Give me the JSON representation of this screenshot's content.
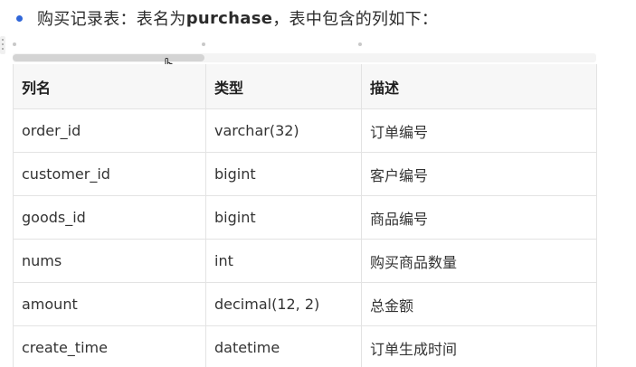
{
  "intro": {
    "prefix": "购买记录表：表名为",
    "table_name": "purchase",
    "suffix": "，表中包含的列如下："
  },
  "table": {
    "headers": [
      "列名",
      "类型",
      "描述"
    ],
    "rows": [
      [
        "order_id",
        "varchar(32)",
        "订单编号"
      ],
      [
        "customer_id",
        "bigint",
        "客户编号"
      ],
      [
        "goods_id",
        "bigint",
        "商品编号"
      ],
      [
        "nums",
        "int",
        "购买商品数量"
      ],
      [
        "amount",
        "decimal(12, 2)",
        "总金额"
      ],
      [
        "create_time",
        "datetime",
        "订单生成时间"
      ]
    ]
  },
  "icons": {
    "bullet": "bullet-dot-icon",
    "cursor": "hand-pointer-icon",
    "handle": "drag-handle-icon"
  },
  "colors": {
    "bullet": "#2f66d8",
    "header_bg": "#f7f7f7",
    "border": "#e3e3e3"
  }
}
